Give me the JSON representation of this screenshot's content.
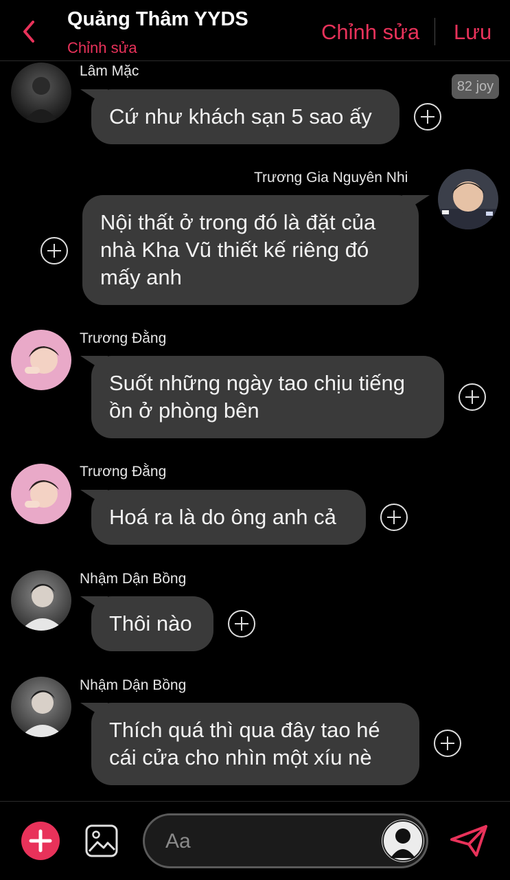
{
  "header": {
    "title": "Quảng Thâm YYDS",
    "subtitle": "Chỉnh sửa",
    "edit_label": "Chỉnh sửa",
    "save_label": "Lưu",
    "accent_color": "#e8325a"
  },
  "messages": [
    {
      "sender": "Lâm Mặc",
      "lines": [
        "Cứ như khách sạn 5 sao ấy"
      ],
      "badge": "82 joy"
    },
    {
      "sender": "Trương Gia Nguyên Nhi",
      "lines": [
        "Nội thất ở trong đó là đặt của",
        "nhà Kha Vũ thiết kế riêng đó",
        "mấy anh"
      ]
    },
    {
      "sender": "Trương Đằng",
      "lines": [
        "Suốt những ngày tao chịu tiếng",
        "ồn ở phòng bên"
      ]
    },
    {
      "sender": "Trương Đằng",
      "lines": [
        "Hoá ra là do ông anh cả"
      ]
    },
    {
      "sender": "Nhậm Dận Bồng",
      "lines": [
        "Thôi nào"
      ]
    },
    {
      "sender": "Nhậm Dận Bồng",
      "lines": [
        "Thích quá thì qua đây tao hé",
        "cái cửa cho nhìn một xíu nè"
      ]
    }
  ],
  "composer": {
    "placeholder": "Aa"
  },
  "icons": {
    "back": "chevron-left-icon",
    "add_reaction": "plus-circle-icon",
    "add": "plus-icon",
    "image": "image-icon",
    "send": "send-icon",
    "persona": "person-silhouette-icon"
  }
}
